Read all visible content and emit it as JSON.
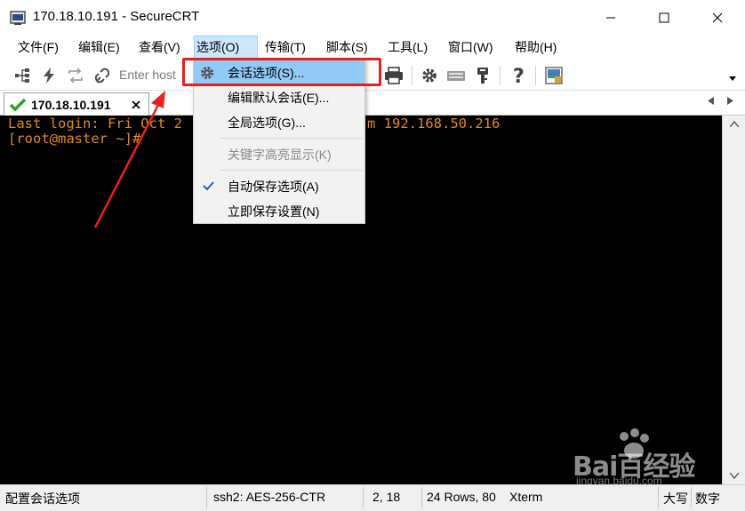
{
  "window": {
    "title": "170.18.10.191 - SecureCRT"
  },
  "menubar": {
    "items": [
      "文件(F)",
      "编辑(E)",
      "查看(V)",
      "选项(O)",
      "传输(T)",
      "脚本(S)",
      "工具(L)",
      "窗口(W)",
      "帮助(H)"
    ],
    "active": "选项(O)"
  },
  "toolbar": {
    "host_placeholder": "Enter host"
  },
  "tab": {
    "label": "170.18.10.191",
    "status": "connected"
  },
  "terminal": {
    "lines": [
      "Last login: Fri Oct 2",
      "[root@master ~]#"
    ],
    "line1_tail": "m 192.168.50.216",
    "text_color": "#e08a1e",
    "background": "#000000"
  },
  "dropdown": {
    "items": [
      {
        "label": "会话选项(S)...",
        "icon": "gear-icon",
        "highlighted": true
      },
      {
        "label": "编辑默认会话(E)..."
      },
      {
        "label": "全局选项(G)..."
      },
      {
        "label": "关键字高亮显示(K)",
        "disabled": true
      },
      {
        "label": "自动保存选项(A)",
        "checked": true
      },
      {
        "label": "立即保存设置(N)"
      }
    ]
  },
  "statusbar": {
    "message": "配置会话选项",
    "protocol": "ssh2: AES-256-CTR",
    "cursor": "2,  18",
    "size": "24 Rows, 80",
    "terminal_type": "Xterm",
    "caps": "大写",
    "numlock": "数字"
  },
  "watermark": {
    "text": "Bai百经验",
    "url": "jingyan.baidu.com"
  },
  "colors": {
    "highlight": "#91c9f7",
    "annotation_red": "#e5221d",
    "menu_active": "#cce8ff"
  }
}
